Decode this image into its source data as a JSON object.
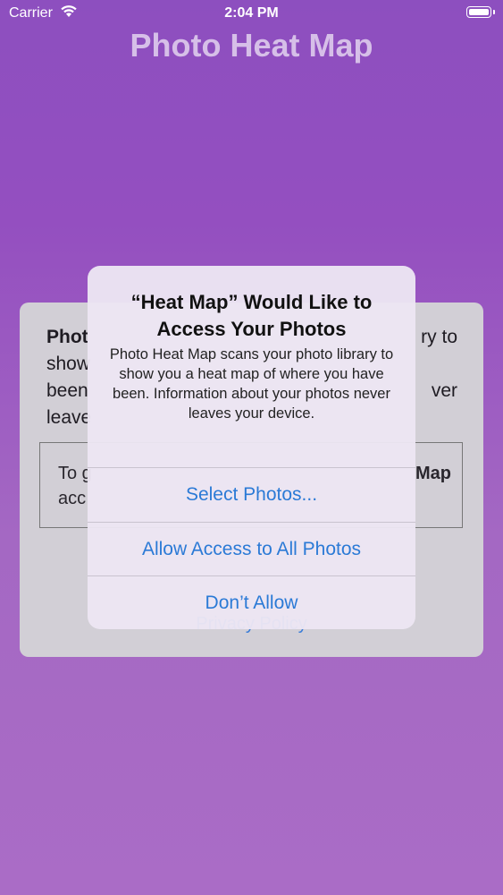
{
  "status_bar": {
    "carrier": "Carrier",
    "time": "2:04 PM",
    "wifi_icon": "wifi-icon",
    "battery_icon": "battery-icon"
  },
  "app": {
    "title": "Photo Heat Map"
  },
  "background_card": {
    "line1_bold": "Phot",
    "line1_end": "ry to",
    "line2": "show",
    "line3": "been",
    "line3_end": "ver",
    "line4": "leave",
    "box_line1": "To g",
    "box_line1_end": "Map",
    "box_line2": "acc",
    "link": "Privacy Policy"
  },
  "alert": {
    "title": "“Heat Map” Would Like to Access Your Photos",
    "message": "Photo Heat Map scans your photo library to show you a heat map of where you have been. Information about your photos never leaves your device.",
    "buttons": {
      "select": "Select Photos...",
      "allow_all": "Allow Access to All Photos",
      "dont_allow": "Don’t Allow"
    }
  },
  "colors": {
    "accent": "#2b7ad6",
    "background_top": "#8d4fbf",
    "background_bottom": "#aa6cc6"
  }
}
